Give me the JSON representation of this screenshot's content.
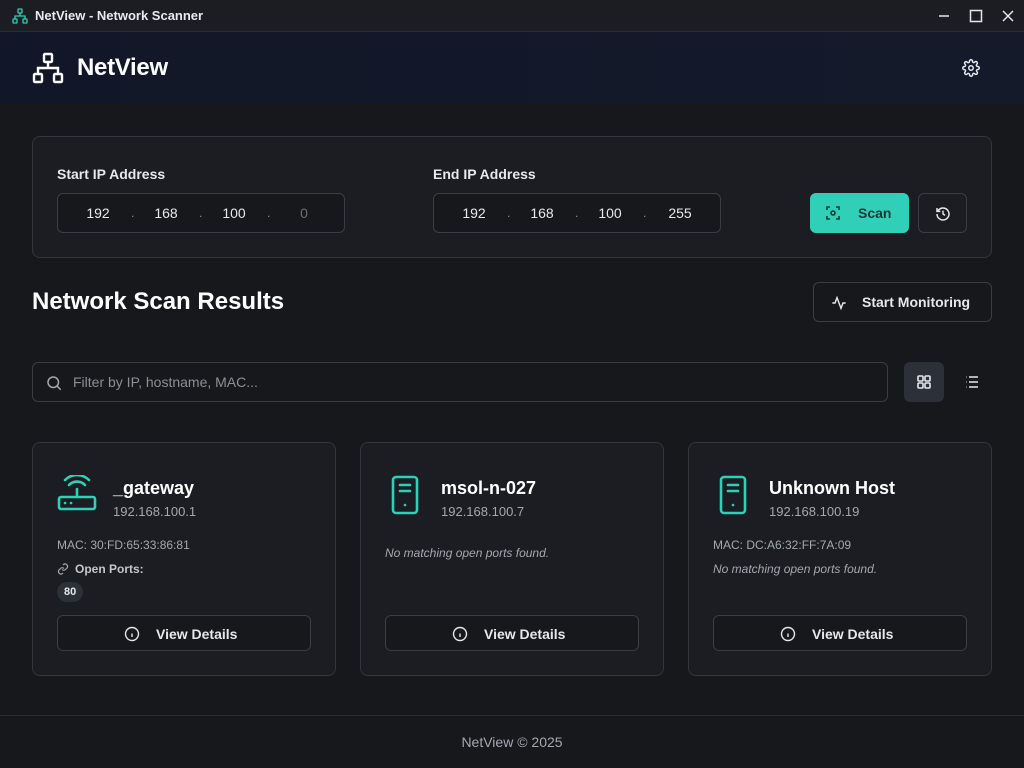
{
  "window": {
    "title": "NetView - Network Scanner",
    "controls": [
      "minimize-icon",
      "maximize-icon",
      "close-icon"
    ]
  },
  "header": {
    "brand": "NetView",
    "logo_icon": "network-icon",
    "settings_icon": "gear-icon"
  },
  "scan_panel": {
    "start_label": "Start IP Address",
    "start_octets": [
      "192",
      "168",
      "100",
      ""
    ],
    "start_placeholder_last": "0",
    "end_label": "End IP Address",
    "end_octets": [
      "192",
      "168",
      "100",
      "255"
    ],
    "scan_button": "Scan",
    "scan_icon": "scan-icon",
    "history_icon": "history-icon"
  },
  "results": {
    "title": "Network Scan Results",
    "monitor_button": "Start Monitoring",
    "monitor_icon": "activity-icon",
    "search_placeholder": "Filter by IP, hostname, MAC...",
    "view_mode": "grid"
  },
  "devices": [
    {
      "hostname": "_gateway",
      "ip": "192.168.100.1",
      "icon": "router-icon",
      "mac": "MAC: 30:FD:65:33:86:81",
      "ports_label": "Open Ports:",
      "ports": [
        "80"
      ],
      "note": "",
      "details_button": "View Details"
    },
    {
      "hostname": "msol-n-027",
      "ip": "192.168.100.7",
      "icon": "server-icon",
      "mac": "",
      "note": "No matching open ports found.",
      "details_button": "View Details"
    },
    {
      "hostname": "Unknown Host",
      "ip": "192.168.100.19",
      "icon": "server-icon",
      "mac": "MAC: DC:A6:32:FF:7A:09",
      "note": "No matching open ports found.",
      "details_button": "View Details"
    }
  ],
  "footer": {
    "copyright": "NetView © 2025"
  },
  "colors": {
    "accent": "#2fd0b7",
    "background": "#16181c",
    "panel": "#1b1d22",
    "border": "#3a3d44"
  }
}
